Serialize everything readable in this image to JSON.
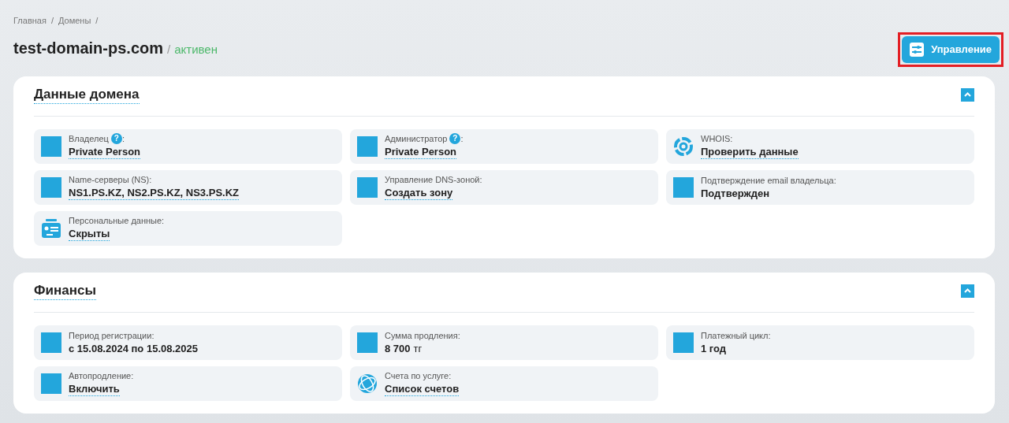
{
  "breadcrumbs": [
    {
      "label": "Главная"
    },
    {
      "label": "Домены"
    }
  ],
  "breadcrumb_separator": "/",
  "title": {
    "domain": "test-domain-ps.com",
    "separator": "/",
    "status": "активен"
  },
  "manage_button": {
    "label": "Управление",
    "highlighted": true
  },
  "sections": [
    {
      "title": "Данные домена",
      "expanded": true,
      "items": [
        {
          "kind": "square",
          "label": "Владелец",
          "help": "?",
          "label_end": ":",
          "value": "Private Person",
          "link": true
        },
        {
          "kind": "square",
          "label": "Администратор",
          "help": "?",
          "label_end": ":",
          "value": "Private Person",
          "link": true
        },
        {
          "kind": "whois",
          "label": "WHOIS:",
          "value": "Проверить данные",
          "link": true
        },
        {
          "kind": "square",
          "label": "Name-серверы (NS):",
          "value": "NS1.PS.KZ, NS2.PS.KZ, NS3.PS.KZ",
          "link": true
        },
        {
          "kind": "square",
          "label": "Управление DNS-зоной:",
          "value": "Создать зону",
          "link": true
        },
        {
          "kind": "square",
          "label": "Подтверждение email владельца:",
          "value": "Подтвержден",
          "link": false
        },
        {
          "kind": "id-card",
          "label": "Персональные данные:",
          "value": "Скрыты",
          "link": true
        }
      ]
    },
    {
      "title": "Финансы",
      "expanded": true,
      "items": [
        {
          "kind": "square",
          "label": "Период регистрации:",
          "value": "с 15.08.2024 по 15.08.2025",
          "link": false
        },
        {
          "kind": "square",
          "label": "Сумма продления:",
          "value": "8 700",
          "unit": "тг",
          "link": false
        },
        {
          "kind": "square",
          "label": "Платежный цикл:",
          "value": "1 год",
          "link": false
        },
        {
          "kind": "square",
          "label": "Автопродление:",
          "value": "Включить",
          "link": true
        },
        {
          "kind": "globe",
          "label": "Счета по услуге:",
          "value": "Список счетов",
          "link": true
        }
      ]
    }
  ]
}
